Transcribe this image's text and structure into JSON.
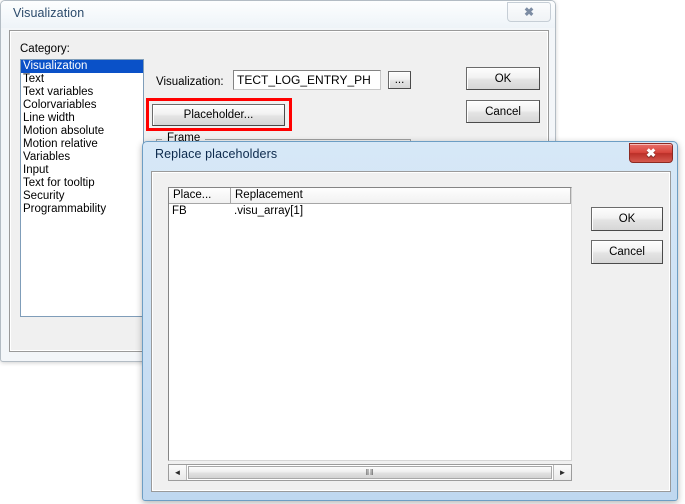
{
  "visualization_dialog": {
    "title": "Visualization",
    "close_icon": "close-icon",
    "category_label": "Category:",
    "categories": [
      "Visualization",
      "Text",
      "Text variables",
      "Colorvariables",
      "Line width",
      "Motion absolute",
      "Motion relative",
      "Variables",
      "Input",
      "Text for tooltip",
      "Security",
      "Programmability"
    ],
    "selected_category": "Visualization",
    "visualization_field_label": "Visualization:",
    "visualization_value": "TECT_LOG_ENTRY_PH",
    "browse_button": "...",
    "placeholder_button": "Placeholder...",
    "frame_group_label": "Frame",
    "ok_button": "OK",
    "cancel_button": "Cancel"
  },
  "replace_dialog": {
    "title": "Replace placeholders",
    "close_icon": "close-icon",
    "table": {
      "columns": [
        "Place...",
        "Replacement"
      ],
      "rows": [
        {
          "placeholder": "FB",
          "replacement": ".visu_array[1]"
        }
      ]
    },
    "ok_button": "OK",
    "cancel_button": "Cancel",
    "scrollbar": {
      "left_arrow": "◄",
      "right_arrow": "►",
      "grip": "‖‖"
    }
  },
  "colors": {
    "selection_blue": "#0a51c8",
    "annotation_red": "#ff0000",
    "active_title_blue": "#cbe0f4",
    "close_red": "#d8453c",
    "dialog_face": "#f0f0f0"
  }
}
